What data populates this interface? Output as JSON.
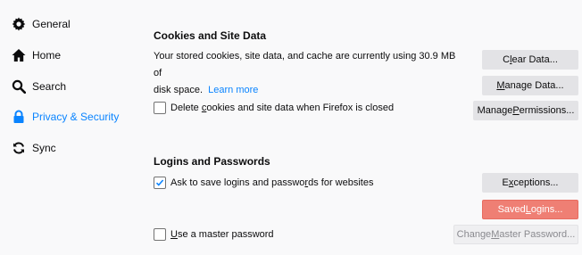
{
  "sidebar": {
    "items": [
      {
        "label": "General",
        "icon": "gear-icon",
        "active": false
      },
      {
        "label": "Home",
        "icon": "home-icon",
        "active": false
      },
      {
        "label": "Search",
        "icon": "search-icon",
        "active": false
      },
      {
        "label": "Privacy & Security",
        "icon": "lock-icon",
        "active": true
      },
      {
        "label": "Sync",
        "icon": "sync-icon",
        "active": false
      }
    ],
    "accent": "#0a84ff"
  },
  "cookies": {
    "heading": "Cookies and Site Data",
    "description_line1": "Your stored cookies, site data, and cache are currently using 30.9 MB of",
    "description_line2": "disk space.",
    "learn_more": "Learn more",
    "delete_on_close": {
      "label_pre": "Delete ",
      "label_access": "c",
      "label_post": "ookies and site data when Firefox is closed",
      "checked": false
    },
    "buttons": {
      "clear": {
        "pre": "C",
        "access": "l",
        "post": "ear Data..."
      },
      "manage": {
        "pre": "",
        "access": "M",
        "post": "anage Data..."
      },
      "permissions": {
        "pre": "Manage ",
        "access": "P",
        "post": "ermissions..."
      }
    }
  },
  "logins": {
    "heading": "Logins and Passwords",
    "ask_to_save": {
      "label_pre": "Ask to save logins and passwo",
      "label_access": "r",
      "label_post": "ds for websites",
      "checked": true
    },
    "master_password": {
      "label_pre": "",
      "label_access": "U",
      "label_post": "se a master password",
      "checked": false
    },
    "buttons": {
      "exceptions": {
        "pre": "E",
        "access": "x",
        "post": "ceptions..."
      },
      "saved_logins": {
        "pre": "Saved ",
        "access": "L",
        "post": "ogins..."
      },
      "change_master": {
        "pre": "Change ",
        "access": "M",
        "post": "aster Password..."
      }
    },
    "highlight_color": "#ef7f74"
  }
}
